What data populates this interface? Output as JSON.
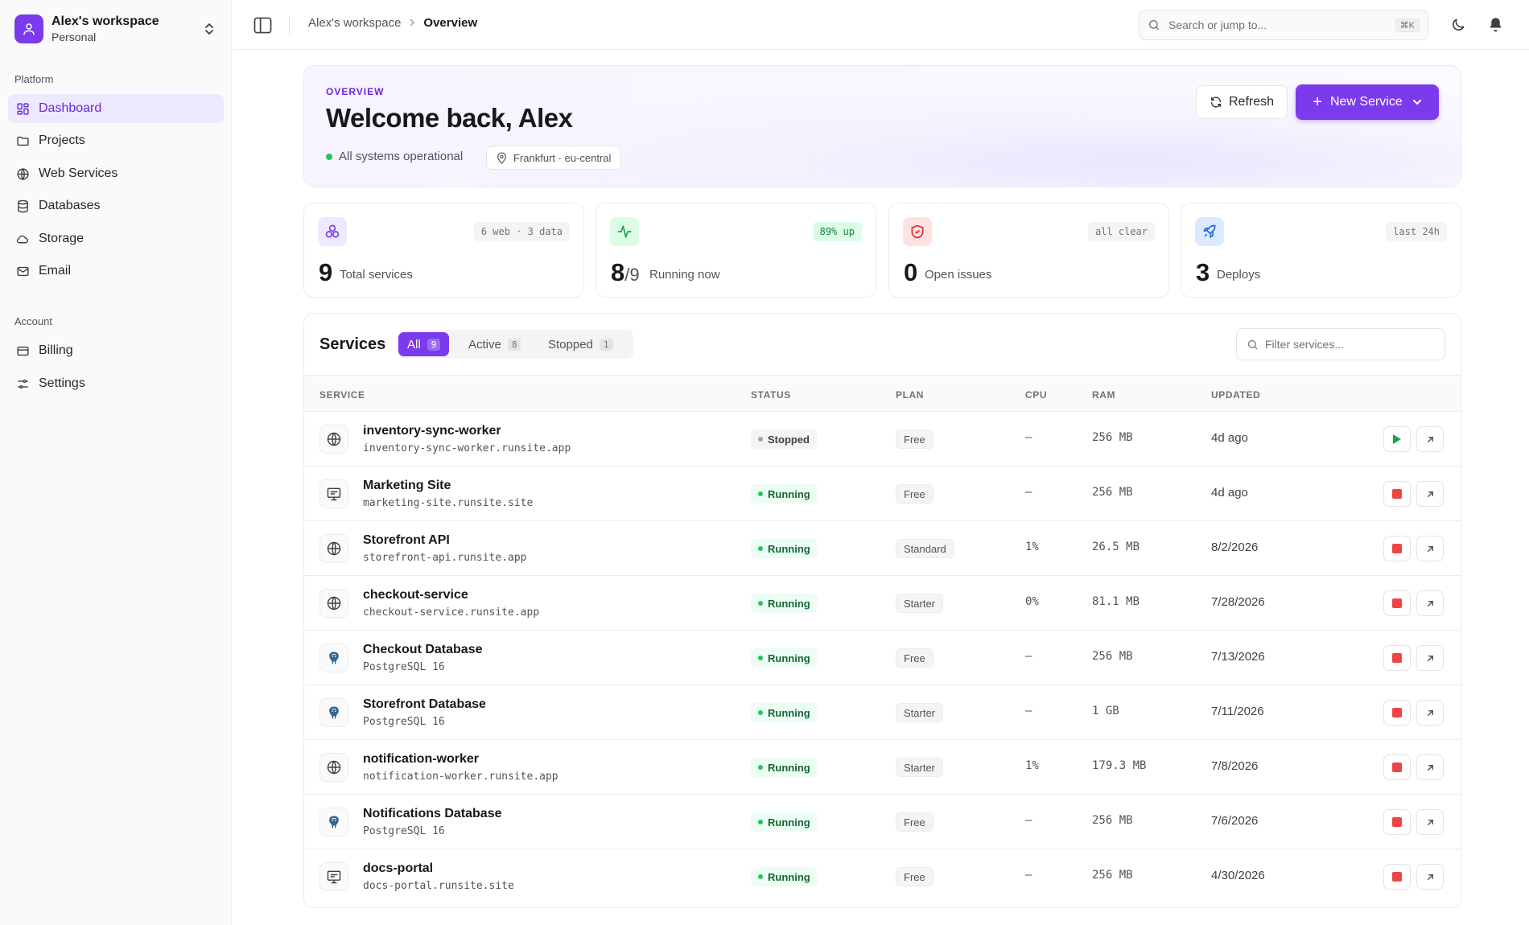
{
  "workspace": {
    "name": "Alex's workspace",
    "plan": "Personal"
  },
  "sidebar": {
    "platform_heading": "Platform",
    "account_heading": "Account",
    "platform_items": [
      {
        "label": "Dashboard",
        "icon": "dashboard-icon",
        "active": true
      },
      {
        "label": "Projects",
        "icon": "folder-icon"
      },
      {
        "label": "Web Services",
        "icon": "globe-icon"
      },
      {
        "label": "Databases",
        "icon": "database-icon"
      },
      {
        "label": "Storage",
        "icon": "cloud-icon"
      },
      {
        "label": "Email",
        "icon": "mail-icon"
      }
    ],
    "account_items": [
      {
        "label": "Billing",
        "icon": "credit-card-icon"
      },
      {
        "label": "Settings",
        "icon": "sliders-icon"
      }
    ]
  },
  "header": {
    "breadcrumb": [
      "Alex's workspace",
      "Overview"
    ],
    "search_placeholder": "Search or jump to...",
    "search_shortcut": "⌘K"
  },
  "hero": {
    "eyebrow": "OVERVIEW",
    "title": "Welcome back, Alex",
    "status": "All systems operational",
    "region": "Frankfurt · eu-central",
    "refresh_label": "Refresh",
    "new_service_label": "New Service"
  },
  "stats": [
    {
      "value": "9",
      "suffix": "",
      "label": "Total services",
      "badge": "6 web · 3 data",
      "icon": "services-icon"
    },
    {
      "value": "8",
      "suffix": "/9",
      "label": "Running now",
      "badge": "89% up",
      "icon": "activity-icon"
    },
    {
      "value": "0",
      "suffix": "",
      "label": "Open issues",
      "badge": "all clear",
      "icon": "shield-icon"
    },
    {
      "value": "3",
      "suffix": "",
      "label": "Deploys",
      "badge": "last 24h",
      "icon": "rocket-icon"
    }
  ],
  "services": {
    "title": "Services",
    "tabs": [
      {
        "label": "All",
        "count": "9",
        "active": true
      },
      {
        "label": "Active",
        "count": "8"
      },
      {
        "label": "Stopped",
        "count": "1"
      }
    ],
    "filter_placeholder": "Filter services...",
    "columns": [
      "SERVICE",
      "STATUS",
      "PLAN",
      "CPU",
      "RAM",
      "UPDATED"
    ],
    "rows": [
      {
        "name": "inventory-sync-worker",
        "sub": "inventory-sync-worker.runsite.app",
        "icon": "globe-icon",
        "status": "Stopped",
        "plan": "Free",
        "cpu": "–",
        "ram": "256 MB",
        "updated": "4d ago"
      },
      {
        "name": "Marketing Site",
        "sub": "marketing-site.runsite.site",
        "icon": "monitor-icon",
        "status": "Running",
        "plan": "Free",
        "cpu": "–",
        "ram": "256 MB",
        "updated": "4d ago"
      },
      {
        "name": "Storefront API",
        "sub": "storefront-api.runsite.app",
        "icon": "globe-icon",
        "status": "Running",
        "plan": "Standard",
        "cpu": "1%",
        "ram": "26.5 MB",
        "updated": "8/2/2026"
      },
      {
        "name": "checkout-service",
        "sub": "checkout-service.runsite.app",
        "icon": "globe-icon",
        "status": "Running",
        "plan": "Starter",
        "cpu": "0%",
        "ram": "81.1 MB",
        "updated": "7/28/2026"
      },
      {
        "name": "Checkout Database",
        "sub": "PostgreSQL 16",
        "icon": "postgres-icon",
        "status": "Running",
        "plan": "Free",
        "cpu": "–",
        "ram": "256 MB",
        "updated": "7/13/2026"
      },
      {
        "name": "Storefront Database",
        "sub": "PostgreSQL 16",
        "icon": "postgres-icon",
        "status": "Running",
        "plan": "Starter",
        "cpu": "–",
        "ram": "1 GB",
        "updated": "7/11/2026"
      },
      {
        "name": "notification-worker",
        "sub": "notification-worker.runsite.app",
        "icon": "globe-icon",
        "status": "Running",
        "plan": "Starter",
        "cpu": "1%",
        "ram": "179.3 MB",
        "updated": "7/8/2026"
      },
      {
        "name": "Notifications Database",
        "sub": "PostgreSQL 16",
        "icon": "postgres-icon",
        "status": "Running",
        "plan": "Free",
        "cpu": "–",
        "ram": "256 MB",
        "updated": "7/6/2026"
      },
      {
        "name": "docs-portal",
        "sub": "docs-portal.runsite.site",
        "icon": "monitor-icon",
        "status": "Running",
        "plan": "Free",
        "cpu": "–",
        "ram": "256 MB",
        "updated": "4/30/2026"
      }
    ]
  },
  "colors": {
    "accent": "#7c3aed",
    "running": "#22c55e",
    "stop": "#ef4444"
  }
}
